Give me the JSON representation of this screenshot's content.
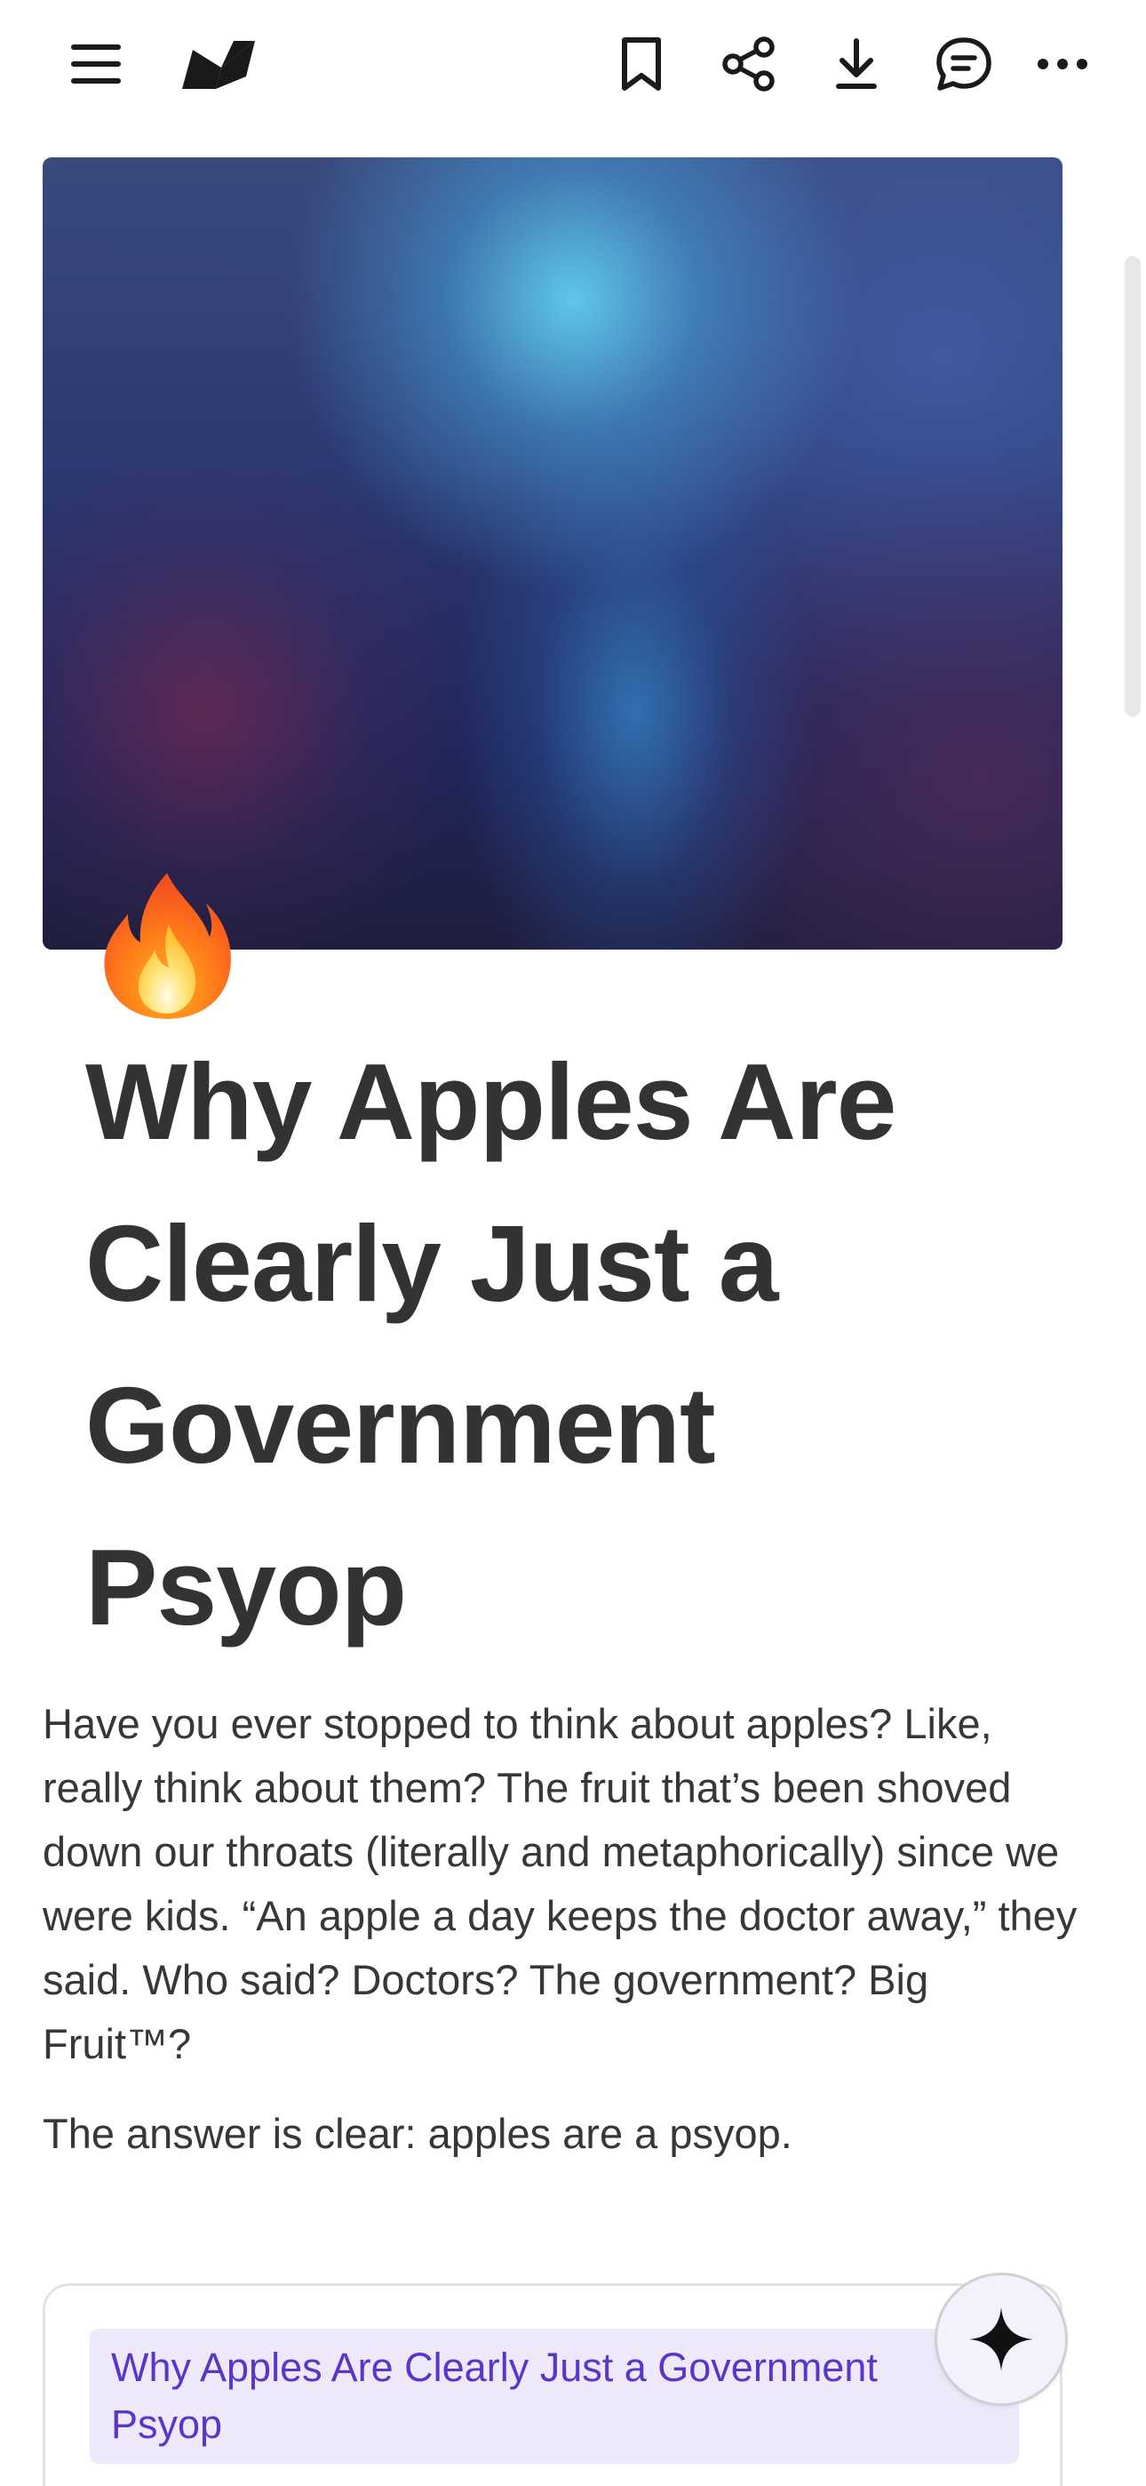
{
  "toolbar": {
    "menu_icon": "hamburger-menu-icon",
    "logo_icon": "app-logo",
    "bookmark_icon": "bookmark-icon",
    "share_icon": "share-icon",
    "download_icon": "download-icon",
    "comment_icon": "comment-icon",
    "more_icon": "more-horizontal-icon"
  },
  "page": {
    "emoji": "🔥",
    "title": "Why Apples Are Clearly Just a Government Psyop",
    "paragraphs": [
      "Have you ever stopped to think about apples? Like, really think about them? The fruit that’s been shoved down our throats (literally and metaphorically) since we were kids. “An apple a day keeps the doctor away,” they said. Who said? Doctors? The government? Big Fruit™?",
      "The answer is clear: apples are a psyop."
    ]
  },
  "toc": {
    "items": [
      "Why Apples Are Clearly Just a Government Psyop"
    ]
  },
  "ai_button": {
    "icon": "sparkle-icon"
  },
  "colors": {
    "text": "#333333",
    "toc_link": "#5b35c9",
    "toc_bg": "#ede9fb",
    "fab_bg": "#f4f1fd"
  }
}
